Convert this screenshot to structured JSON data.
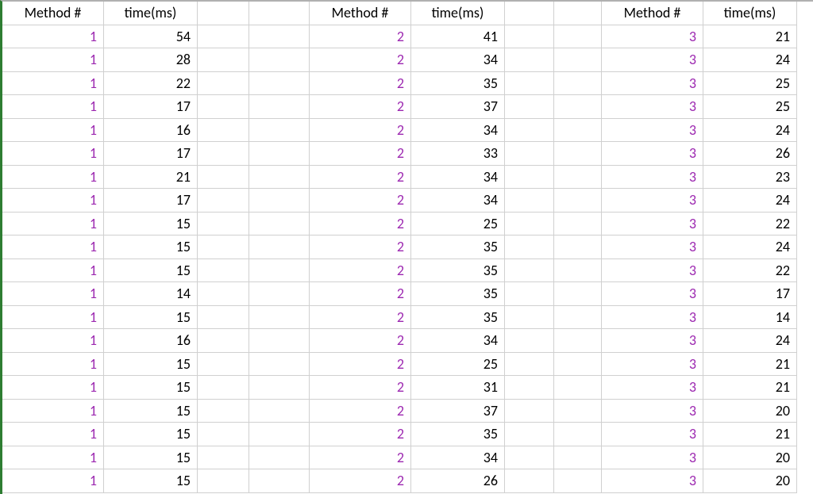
{
  "headers": {
    "method": "Method #",
    "time": "time(ms)"
  },
  "colors": {
    "method_value": "#9c27b0"
  },
  "blocks": [
    {
      "method": 1,
      "times": [
        54,
        28,
        22,
        17,
        16,
        17,
        21,
        17,
        15,
        15,
        15,
        14,
        15,
        16,
        15,
        15,
        15,
        15,
        15,
        15
      ]
    },
    {
      "method": 2,
      "times": [
        41,
        34,
        35,
        37,
        34,
        33,
        34,
        34,
        25,
        35,
        35,
        35,
        35,
        34,
        25,
        31,
        37,
        35,
        34,
        26
      ]
    },
    {
      "method": 3,
      "times": [
        21,
        24,
        25,
        25,
        24,
        26,
        23,
        24,
        22,
        24,
        22,
        17,
        14,
        24,
        21,
        21,
        20,
        21,
        20,
        20
      ]
    }
  ]
}
